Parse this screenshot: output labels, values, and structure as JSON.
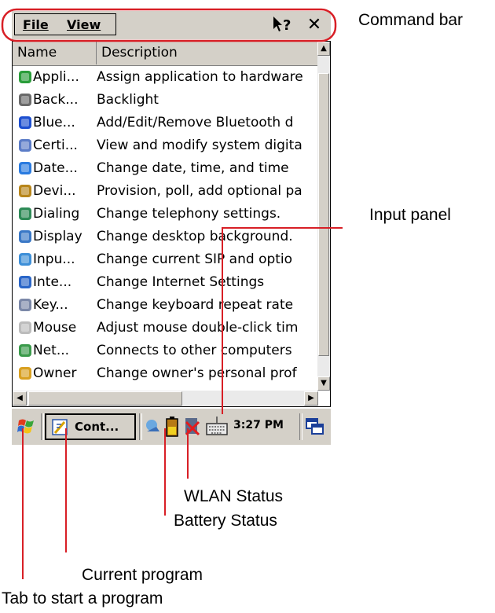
{
  "menu": {
    "file_label": "File",
    "view_label": "View"
  },
  "list": {
    "columns": [
      "Name",
      "Description"
    ],
    "rows": [
      {
        "name": "Appli...",
        "description": "Assign application to hardware",
        "icon": "application-icon"
      },
      {
        "name": "Back...",
        "description": "Backlight",
        "icon": "backlight-icon"
      },
      {
        "name": "Blue...",
        "description": "Add/Edit/Remove Bluetooth d",
        "icon": "bluetooth-icon"
      },
      {
        "name": "Certi...",
        "description": "View and modify system digita",
        "icon": "certificates-icon"
      },
      {
        "name": "Date...",
        "description": "Change date, time, and time",
        "icon": "date-time-icon"
      },
      {
        "name": "Devi...",
        "description": "Provision, poll, add optional pa",
        "icon": "device-management-icon"
      },
      {
        "name": "Dialing",
        "description": "Change telephony settings.",
        "icon": "dialing-icon"
      },
      {
        "name": "Display",
        "description": "Change desktop background.",
        "icon": "display-icon"
      },
      {
        "name": "Inpu...",
        "description": "Change current SIP and optio",
        "icon": "input-panel-icon"
      },
      {
        "name": "Inte...",
        "description": "Change Internet Settings",
        "icon": "internet-options-icon"
      },
      {
        "name": "Key...",
        "description": "Change keyboard repeat rate",
        "icon": "keyboard-icon"
      },
      {
        "name": "Mouse",
        "description": "Adjust mouse double-click tim",
        "icon": "mouse-icon"
      },
      {
        "name": "Net...",
        "description": "Connects to other computers",
        "icon": "network-icon"
      },
      {
        "name": "Owner",
        "description": "Change owner's personal prof",
        "icon": "owner-icon"
      }
    ]
  },
  "taskbar": {
    "current_program": "Cont...",
    "time": "3:27 PM"
  },
  "annotations": {
    "command_bar": "Command bar",
    "input_panel": "Input panel",
    "wlan_status": "WLAN Status",
    "battery_status": "Battery Status",
    "current_program": "Current program",
    "start": "Tab to start a program"
  },
  "colors": {
    "callout": "#d81f26",
    "chrome": "#d4d0c8"
  }
}
